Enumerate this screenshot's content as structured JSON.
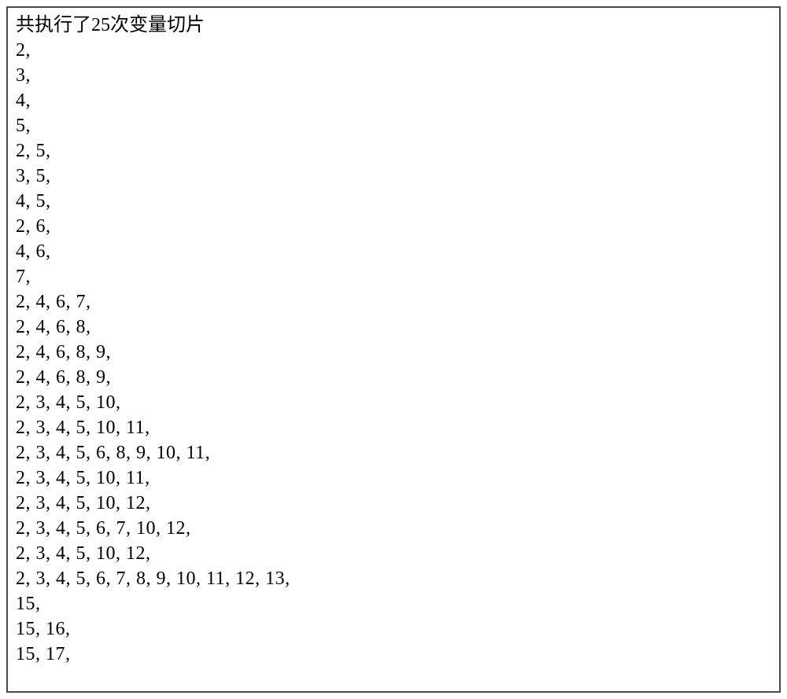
{
  "header": "共执行了25次变量切片",
  "lines": [
    "2,",
    "3,",
    "4,",
    "5,",
    "2, 5,",
    "3, 5,",
    "4, 5,",
    "2, 6,",
    "4, 6,",
    "7,",
    "2, 4, 6, 7,",
    "2, 4, 6, 8,",
    "2, 4, 6, 8, 9,",
    "2, 4, 6, 8, 9,",
    "2, 3, 4, 5, 10,",
    "2, 3, 4, 5, 10, 11,",
    "2, 3, 4, 5, 6, 8, 9, 10, 11,",
    "2, 3, 4, 5, 10, 11,",
    "2, 3, 4, 5, 10, 12,",
    "2, 3, 4, 5, 6, 7, 10, 12,",
    "2, 3, 4, 5, 10, 12,",
    "2, 3, 4, 5, 6, 7, 8, 9, 10, 11, 12, 13,",
    "15,",
    "15, 16,",
    "15, 17,"
  ]
}
